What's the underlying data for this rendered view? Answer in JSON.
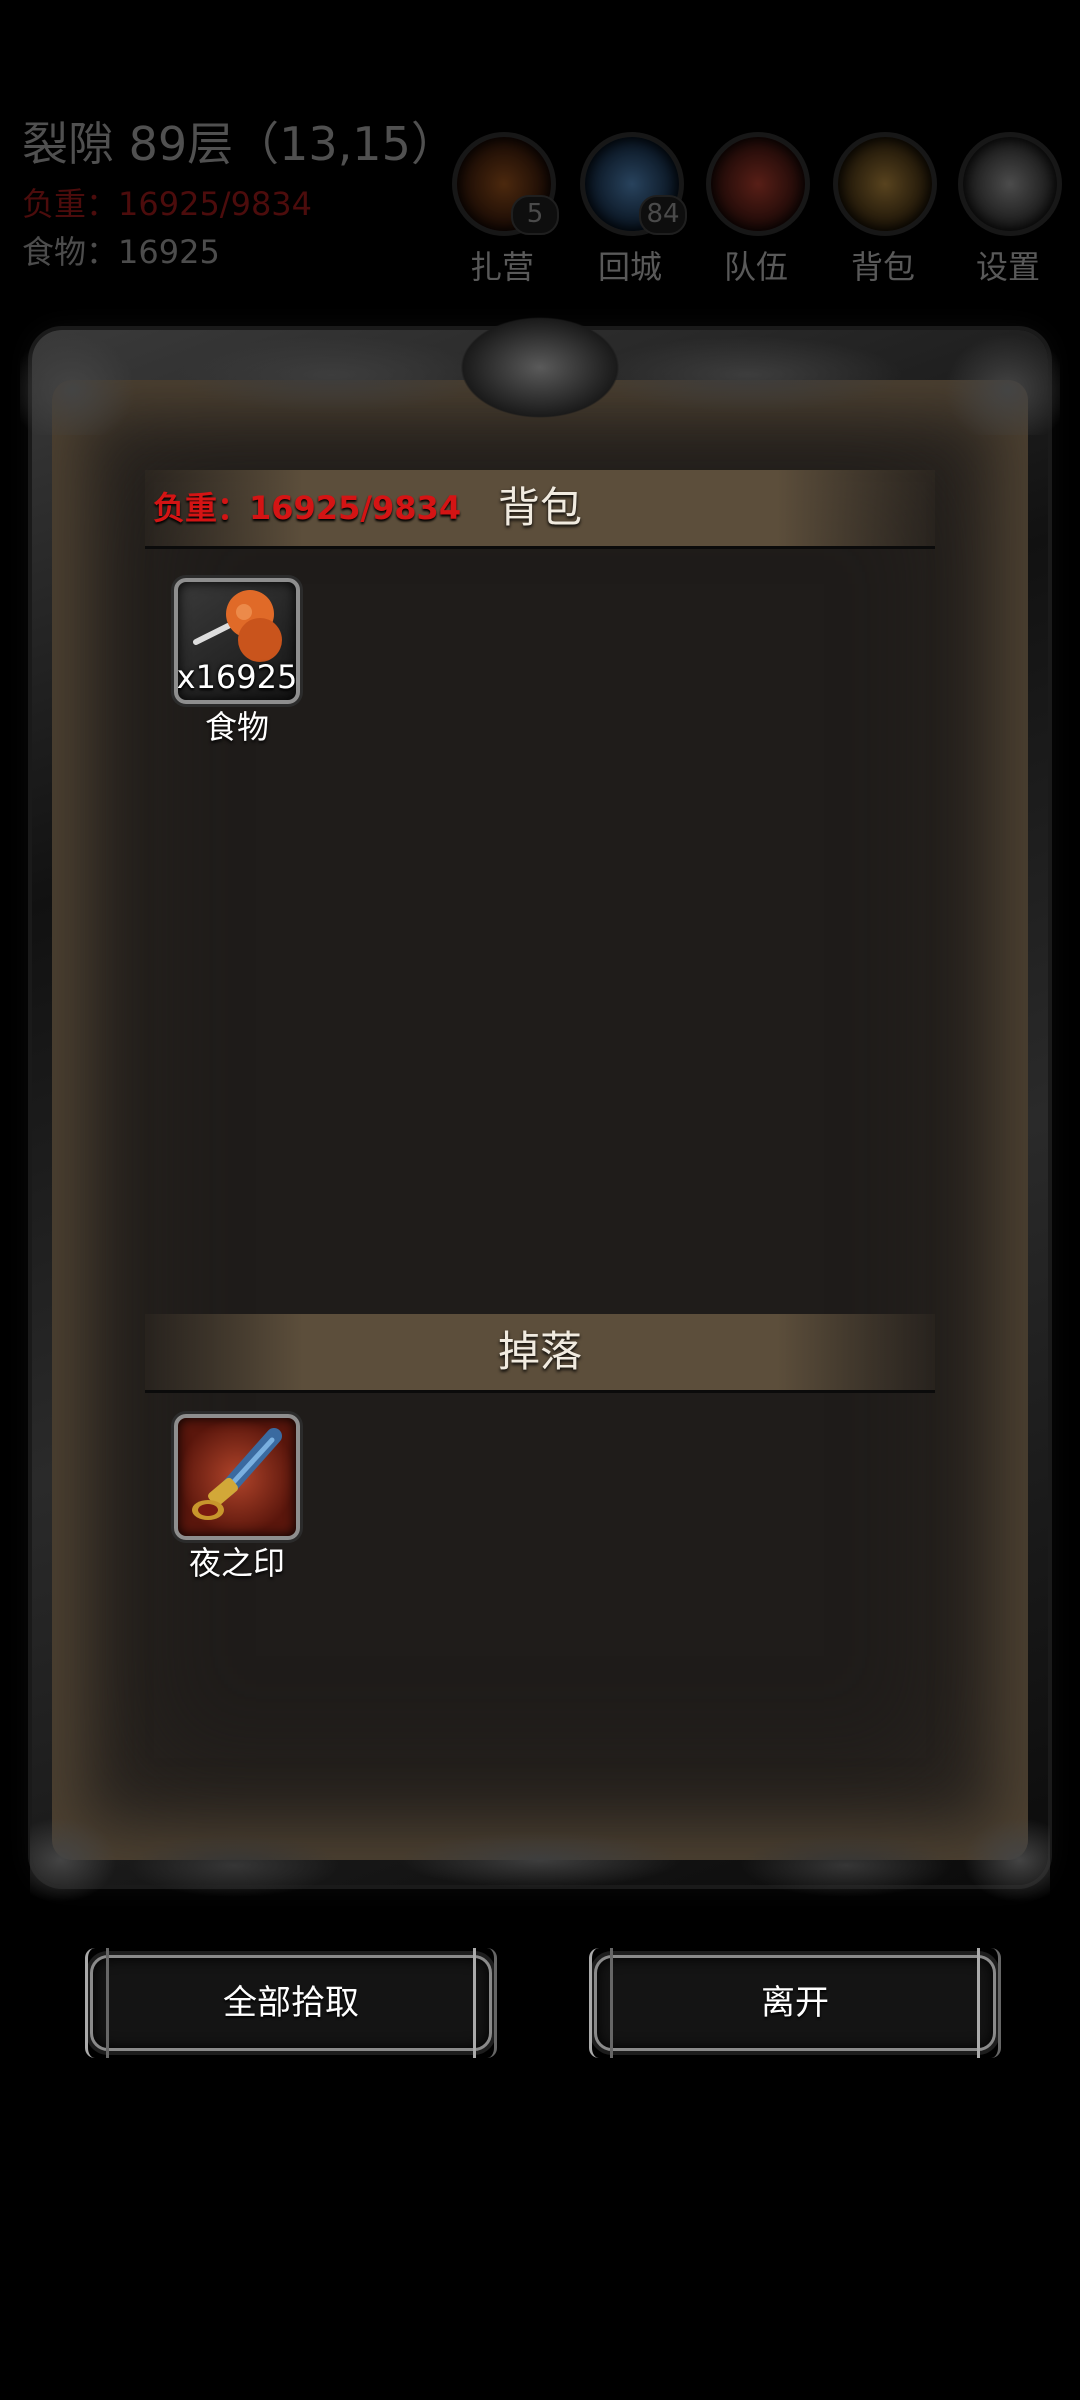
{
  "status": {
    "location": "裂隙 89层（13,15）",
    "load_label": "负重：16925/9834",
    "food_label": "食物：16925"
  },
  "top_buttons": [
    {
      "label": "扎营",
      "badge": "5",
      "icon": "campfire-icon"
    },
    {
      "label": "回城",
      "badge": "84",
      "icon": "portal-icon"
    },
    {
      "label": "队伍",
      "badge": "",
      "icon": "team-icon"
    },
    {
      "label": "背包",
      "badge": "",
      "icon": "backpack-icon"
    },
    {
      "label": "设置",
      "badge": "",
      "icon": "gear-icon"
    }
  ],
  "backpack": {
    "title": "背包",
    "weight_label": "负重：16925/9834",
    "items": [
      {
        "name": "食物",
        "quantity": "x16925",
        "icon": "meat-icon"
      }
    ]
  },
  "drops": {
    "title": "掉落",
    "items": [
      {
        "name": "夜之印",
        "quantity": "",
        "icon": "seal-icon"
      }
    ]
  },
  "buttons": {
    "pickup_all": "全部拾取",
    "leave": "离开"
  },
  "colors": {
    "weight_red": "#d41414",
    "background": "#000000",
    "parchment": "#1f1c1a"
  }
}
